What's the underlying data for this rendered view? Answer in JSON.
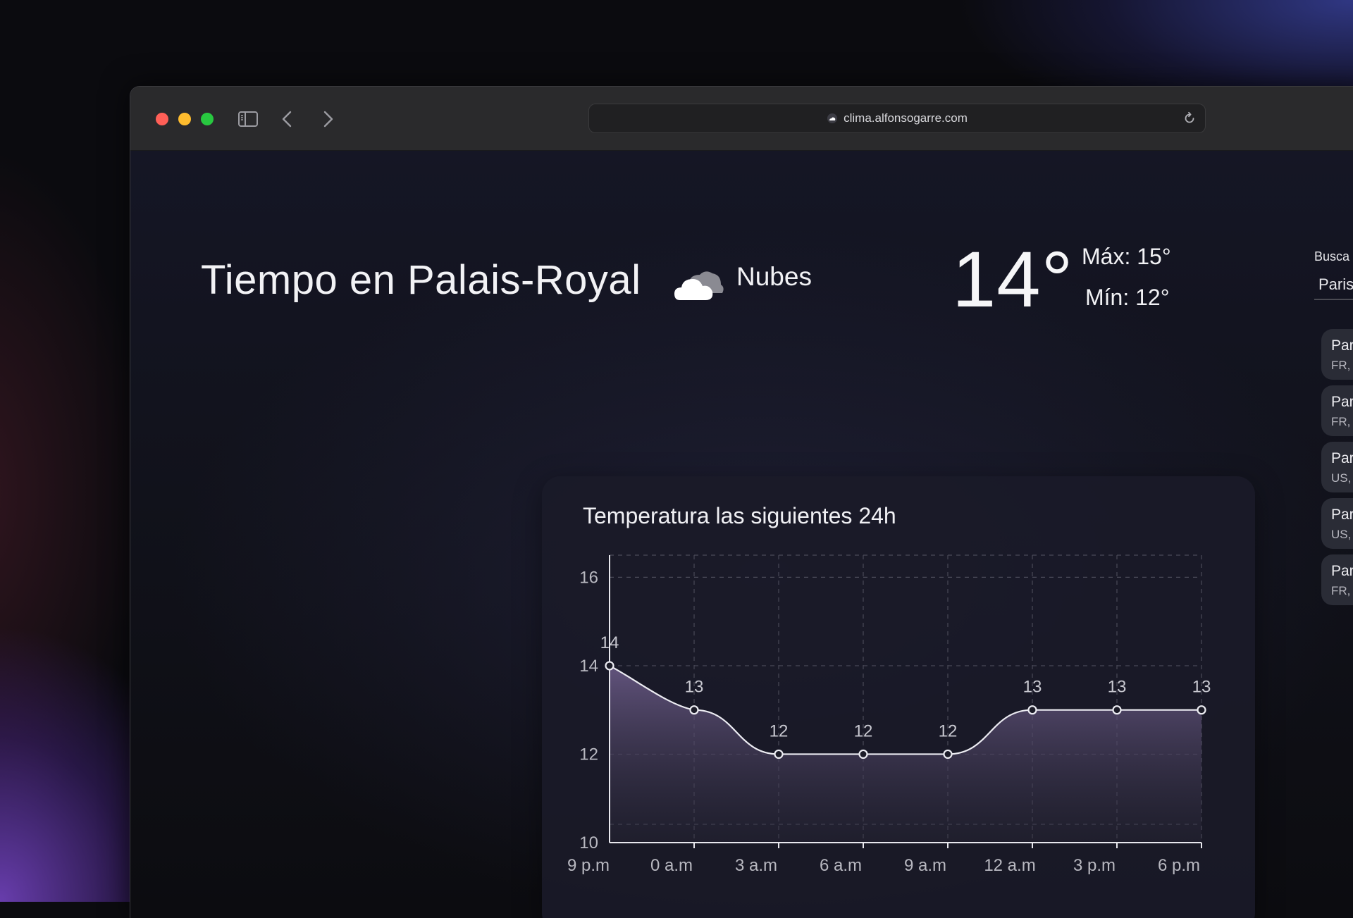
{
  "browser": {
    "url": "clima.alfonsogarre.com"
  },
  "header": {
    "title": "Tiempo en Palais-Royal",
    "condition": "Nubes",
    "condition_icon": "cloud-icon",
    "temperature": "14°",
    "max": "Máx: 15°",
    "min": "Mín: 12°"
  },
  "search": {
    "label": "Busca",
    "value": "Paris",
    "results": [
      {
        "name": "Par",
        "country": "FR,"
      },
      {
        "name": "Par",
        "country": "FR,"
      },
      {
        "name": "Par",
        "country": "US,"
      },
      {
        "name": "Par",
        "country": "US,"
      },
      {
        "name": "Par",
        "country": "FR,"
      }
    ]
  },
  "chart": {
    "title": "Temperatura las siguientes 24h"
  },
  "chart_data": {
    "type": "area",
    "title": "Temperatura las siguientes 24h",
    "x": [
      "9 p.m",
      "0 a.m",
      "3 a.m",
      "6 a.m",
      "9 a.m",
      "12 a.m",
      "3 p.m",
      "6 p.m"
    ],
    "values": [
      14,
      13,
      12,
      12,
      12,
      13,
      13,
      13
    ],
    "y_ticks": [
      10,
      12,
      14,
      16
    ],
    "ylim": [
      10,
      16.5
    ],
    "grid": true,
    "data_labels": true
  }
}
